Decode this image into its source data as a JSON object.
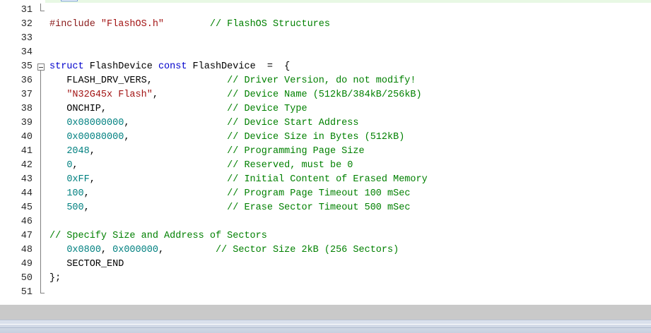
{
  "editor": {
    "lines": [
      {
        "num": "31",
        "fold": "end",
        "segments": []
      },
      {
        "num": "32",
        "segments": [
          {
            "cls": "tok-pp",
            "text": "#include "
          },
          {
            "cls": "tok-str",
            "text": "\"FlashOS.h\""
          },
          {
            "cls": "tok-id",
            "text": "        "
          },
          {
            "cls": "tok-cm",
            "text": "// FlashOS Structures"
          }
        ]
      },
      {
        "num": "33",
        "segments": []
      },
      {
        "num": "34",
        "segments": []
      },
      {
        "num": "35",
        "fold": "open",
        "segments": [
          {
            "cls": "tok-kw",
            "text": "struct"
          },
          {
            "cls": "tok-id",
            "text": " FlashDevice "
          },
          {
            "cls": "tok-kw",
            "text": "const"
          },
          {
            "cls": "tok-id",
            "text": " FlashDevice  =  {"
          }
        ]
      },
      {
        "num": "36",
        "fold": "line",
        "segments": [
          {
            "cls": "tok-id",
            "text": "   FLASH_DRV_VERS,             "
          },
          {
            "cls": "tok-cm",
            "text": "// Driver Version, do not modify!"
          }
        ]
      },
      {
        "num": "37",
        "fold": "line",
        "segments": [
          {
            "cls": "tok-id",
            "text": "   "
          },
          {
            "cls": "tok-str",
            "text": "\"N32G45x Flash\""
          },
          {
            "cls": "tok-id",
            "text": ",            "
          },
          {
            "cls": "tok-cm",
            "text": "// Device Name (512kB/384kB/256kB)"
          }
        ]
      },
      {
        "num": "38",
        "fold": "line",
        "segments": [
          {
            "cls": "tok-id",
            "text": "   ONCHIP,                     "
          },
          {
            "cls": "tok-cm",
            "text": "// Device Type"
          }
        ]
      },
      {
        "num": "39",
        "fold": "line",
        "segments": [
          {
            "cls": "tok-id",
            "text": "   "
          },
          {
            "cls": "tok-num",
            "text": "0x08000000"
          },
          {
            "cls": "tok-id",
            "text": ",                 "
          },
          {
            "cls": "tok-cm",
            "text": "// Device Start Address"
          }
        ]
      },
      {
        "num": "40",
        "fold": "line",
        "segments": [
          {
            "cls": "tok-id",
            "text": "   "
          },
          {
            "cls": "tok-num",
            "text": "0x00080000"
          },
          {
            "cls": "tok-id",
            "text": ",                 "
          },
          {
            "cls": "tok-cm",
            "text": "// Device Size in Bytes (512kB)"
          }
        ]
      },
      {
        "num": "41",
        "fold": "line",
        "segments": [
          {
            "cls": "tok-id",
            "text": "   "
          },
          {
            "cls": "tok-num",
            "text": "2048"
          },
          {
            "cls": "tok-id",
            "text": ",                       "
          },
          {
            "cls": "tok-cm",
            "text": "// Programming Page Size"
          }
        ]
      },
      {
        "num": "42",
        "fold": "line",
        "segments": [
          {
            "cls": "tok-id",
            "text": "   "
          },
          {
            "cls": "tok-num",
            "text": "0"
          },
          {
            "cls": "tok-id",
            "text": ",                          "
          },
          {
            "cls": "tok-cm",
            "text": "// Reserved, must be 0"
          }
        ]
      },
      {
        "num": "43",
        "fold": "line",
        "segments": [
          {
            "cls": "tok-id",
            "text": "   "
          },
          {
            "cls": "tok-num",
            "text": "0xFF"
          },
          {
            "cls": "tok-id",
            "text": ",                       "
          },
          {
            "cls": "tok-cm",
            "text": "// Initial Content of Erased Memory"
          }
        ]
      },
      {
        "num": "44",
        "fold": "line",
        "segments": [
          {
            "cls": "tok-id",
            "text": "   "
          },
          {
            "cls": "tok-num",
            "text": "100"
          },
          {
            "cls": "tok-id",
            "text": ",                        "
          },
          {
            "cls": "tok-cm",
            "text": "// Program Page Timeout 100 mSec"
          }
        ]
      },
      {
        "num": "45",
        "fold": "line",
        "segments": [
          {
            "cls": "tok-id",
            "text": "   "
          },
          {
            "cls": "tok-num",
            "text": "500"
          },
          {
            "cls": "tok-id",
            "text": ",                        "
          },
          {
            "cls": "tok-cm",
            "text": "// Erase Sector Timeout 500 mSec"
          }
        ]
      },
      {
        "num": "46",
        "fold": "line",
        "segments": []
      },
      {
        "num": "47",
        "fold": "line",
        "segments": [
          {
            "cls": "tok-cm",
            "text": "// Specify Size and Address of Sectors"
          }
        ]
      },
      {
        "num": "48",
        "fold": "line",
        "segments": [
          {
            "cls": "tok-id",
            "text": "   "
          },
          {
            "cls": "tok-num",
            "text": "0x0800"
          },
          {
            "cls": "tok-id",
            "text": ", "
          },
          {
            "cls": "tok-num",
            "text": "0x000000"
          },
          {
            "cls": "tok-id",
            "text": ",         "
          },
          {
            "cls": "tok-cm",
            "text": "// Sector Size 2kB (256 Sectors)"
          }
        ]
      },
      {
        "num": "49",
        "fold": "line",
        "segments": [
          {
            "cls": "tok-id",
            "text": "   SECTOR_END"
          }
        ]
      },
      {
        "num": "50",
        "fold": "line",
        "segments": [
          {
            "cls": "tok-id",
            "text": "};"
          }
        ]
      },
      {
        "num": "51",
        "fold": "end",
        "segments": []
      }
    ]
  }
}
